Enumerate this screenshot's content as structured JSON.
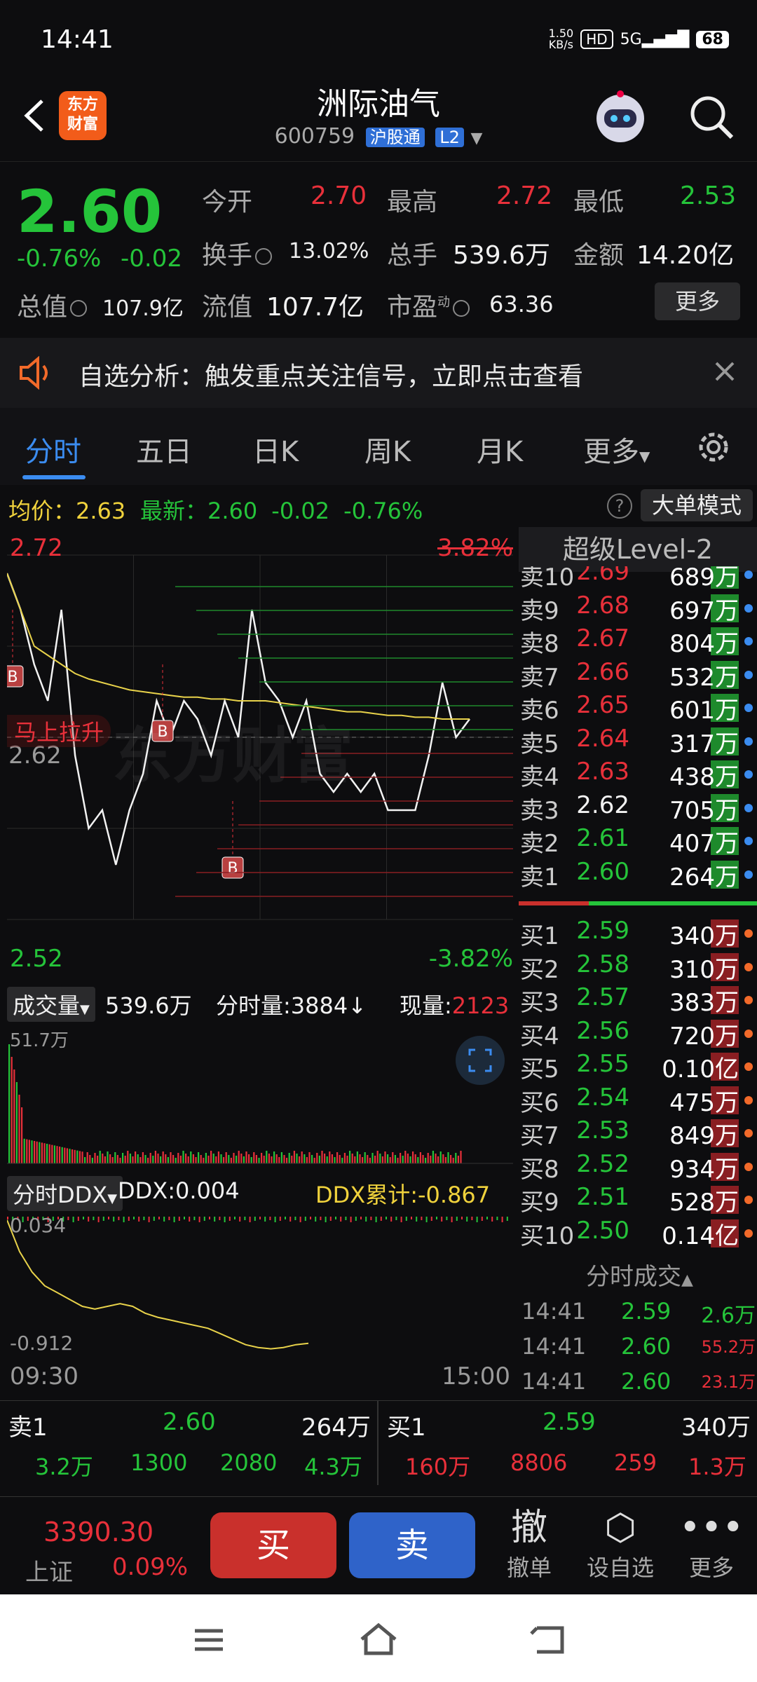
{
  "status": {
    "time": "14:41",
    "net_speed": "1.50\nKB/s",
    "hd": "HD",
    "signal": "5G",
    "battery": "68"
  },
  "header": {
    "logo_line1": "东方",
    "logo_line2": "财富",
    "name": "洲际油气",
    "code": "600759",
    "exchange_tag": "沪股通",
    "level_tag": "L2"
  },
  "quote": {
    "price": "2.60",
    "chg_pct": "-0.76%",
    "chg_val": "-0.02",
    "open_label": "今开",
    "open": "2.70",
    "high_label": "最高",
    "high": "2.72",
    "low_label": "最低",
    "low": "2.53",
    "turnover_label": "换手",
    "turnover": "13.02%",
    "volume_label": "总手",
    "volume": "539.6万",
    "amount_label": "金额",
    "amount": "14.20亿",
    "mcap_label": "总值",
    "mcap": "107.9亿",
    "float_label": "流值",
    "float": "107.7亿",
    "pe_label": "市盈",
    "pe_sup": "动",
    "pe": "63.36",
    "more": "更多"
  },
  "banner": {
    "text": "自选分析：触发重点关注信号，立即点击查看"
  },
  "tabs": [
    "分时",
    "五日",
    "日K",
    "周K",
    "月K",
    "更多"
  ],
  "avgbar": {
    "avg_label": "均价：",
    "avg": "2.63",
    "latest_label": "最新：",
    "latest": "2.60",
    "chg": "-0.02",
    "pct": "-0.76%",
    "help": "?",
    "bigorder": "大单模式"
  },
  "chart": {
    "max_price": "2.72",
    "max_pct": "3.82%",
    "min_price": "2.52",
    "min_pct": "-3.82%",
    "ref_price": "2.62",
    "promo": "马上拉升",
    "watermark": "东方财富",
    "vol_label": "成交量",
    "vol_total": "539.6万",
    "tick_label": "分时量:",
    "tick_val": "3884",
    "tick_arrow": "↓",
    "cur_label": "现量:",
    "cur_val": "2123",
    "vol_max": "51.7万",
    "ddx_label": "分时DDX",
    "ddx": "DDX:0.004",
    "ddx_cum": "DDX累计:-0.867",
    "ddx_top": "0.034",
    "ddx_bottom": "-0.912",
    "time_start": "09:30",
    "time_end": "15:00",
    "buy_marker": "B"
  },
  "chart_data": {
    "type": "line",
    "title": "",
    "series": [
      {
        "values": [
          2.71,
          2.69,
          2.66,
          2.64,
          2.69,
          2.61,
          2.57,
          2.58,
          2.55,
          2.58,
          2.6,
          2.64,
          2.62,
          2.64,
          2.63,
          2.61,
          2.64,
          2.62,
          2.69,
          2.65,
          2.64,
          2.62,
          2.64,
          2.6,
          2.59,
          2.6,
          2.59,
          2.6,
          2.58,
          2.58,
          2.58,
          2.61,
          2.65,
          2.62,
          2.63
        ]
      },
      {
        "values": [
          2.71,
          2.69,
          2.67,
          2.665,
          2.66,
          2.655,
          2.652,
          2.65,
          2.648,
          2.646,
          2.645,
          2.644,
          2.643,
          2.642,
          2.642,
          2.641,
          2.641,
          2.64,
          2.64,
          2.64,
          2.639,
          2.638,
          2.637,
          2.636,
          2.635,
          2.634,
          2.634,
          2.633,
          2.632,
          2.632,
          2.631,
          2.631,
          2.63,
          2.63,
          2.63
        ]
      }
    ],
    "ylim": [
      2.52,
      2.72
    ]
  },
  "orderbook": {
    "header": "超级Level-2",
    "asks": [
      {
        "label": "卖10",
        "price": "2.69",
        "vol": "689万"
      },
      {
        "label": "卖9",
        "price": "2.68",
        "vol": "697万"
      },
      {
        "label": "卖8",
        "price": "2.67",
        "vol": "804万"
      },
      {
        "label": "卖7",
        "price": "2.66",
        "vol": "532万"
      },
      {
        "label": "卖6",
        "price": "2.65",
        "vol": "601万"
      },
      {
        "label": "卖5",
        "price": "2.64",
        "vol": "317万"
      },
      {
        "label": "卖4",
        "price": "2.63",
        "vol": "438万"
      },
      {
        "label": "卖3",
        "price": "2.62",
        "vol": "705万"
      },
      {
        "label": "卖2",
        "price": "2.61",
        "vol": "407万"
      },
      {
        "label": "卖1",
        "price": "2.60",
        "vol": "264万"
      }
    ],
    "bids": [
      {
        "label": "买1",
        "price": "2.59",
        "vol": "340万"
      },
      {
        "label": "买2",
        "price": "2.58",
        "vol": "310万"
      },
      {
        "label": "买3",
        "price": "2.57",
        "vol": "383万"
      },
      {
        "label": "买4",
        "price": "2.56",
        "vol": "720万"
      },
      {
        "label": "买5",
        "price": "2.55",
        "vol": "0.10亿"
      },
      {
        "label": "买6",
        "price": "2.54",
        "vol": "475万"
      },
      {
        "label": "买7",
        "price": "2.53",
        "vol": "849万"
      },
      {
        "label": "买8",
        "price": "2.52",
        "vol": "934万"
      },
      {
        "label": "买9",
        "price": "2.51",
        "vol": "528万"
      },
      {
        "label": "买10",
        "price": "2.50",
        "vol": "0.14亿"
      }
    ],
    "trades_title": "分时成交",
    "trades": [
      {
        "time": "14:41",
        "price": "2.59",
        "vol": "2.6万"
      },
      {
        "time": "14:41",
        "price": "2.60",
        "vol": "55.2万"
      },
      {
        "time": "14:41",
        "price": "2.60",
        "vol": "23.1万"
      }
    ]
  },
  "bottom": {
    "sell1_label": "卖1",
    "sell1_price": "2.60",
    "sell1_vol": "264万",
    "buy1_label": "买1",
    "buy1_price": "2.59",
    "buy1_vol": "340万",
    "left_cells": [
      "3.2万",
      "1300",
      "2080",
      "4.3万"
    ],
    "right_cells": [
      "160万",
      "8806",
      "259",
      "1.3万"
    ]
  },
  "toolbar": {
    "index_val": "3390.30",
    "index_name": "上证",
    "index_pct": "0.09%",
    "buy": "买",
    "sell": "卖",
    "cancel_icon": "撤",
    "cancel": "撤单",
    "watch": "设自选",
    "more": "更多"
  }
}
